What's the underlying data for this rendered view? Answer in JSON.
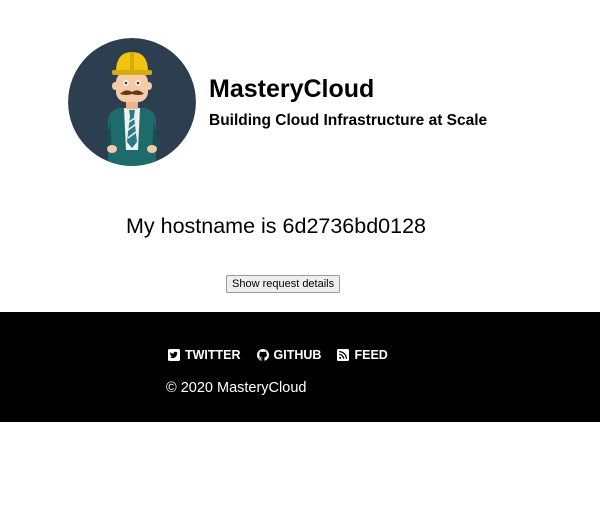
{
  "header": {
    "title": "MasteryCloud",
    "tagline": "Building Cloud Infrastructure at Scale",
    "avatar_icon": "construction-worker-avatar"
  },
  "main": {
    "hostname_text": "My hostname is 6d2736bd0128",
    "details_button_label": "Show request details"
  },
  "footer": {
    "links": [
      {
        "label": "TWITTER",
        "icon": "twitter-icon"
      },
      {
        "label": "GITHUB",
        "icon": "github-icon"
      },
      {
        "label": "FEED",
        "icon": "rss-feed-icon"
      }
    ],
    "copyright": "© 2020 MasteryCloud"
  },
  "colors": {
    "avatar_background": "#2c3e50",
    "footer_background": "#000000",
    "footer_text": "#ffffff",
    "hard_hat": "#f1c40f",
    "jacket": "#16a085"
  }
}
